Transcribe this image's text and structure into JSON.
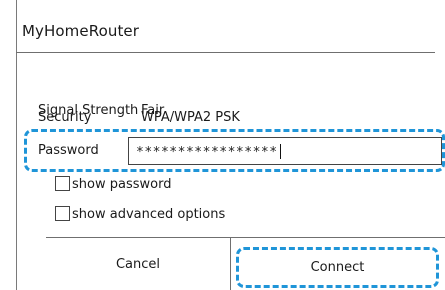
{
  "dialog": {
    "title": "MyHomeRouter",
    "signal_label": "Signal Strength",
    "signal_value": "Fair",
    "security_label": "Security",
    "security_value": "WPA/WPA2  PSK",
    "password_label": "Password",
    "password_value": "*****************",
    "show_password_label": "show password",
    "show_password_checked": false,
    "show_advanced_label": "show advanced options",
    "show_advanced_checked": false,
    "cancel_label": "Cancel",
    "connect_label": "Connect",
    "highlight_color": "#1f95d8"
  }
}
